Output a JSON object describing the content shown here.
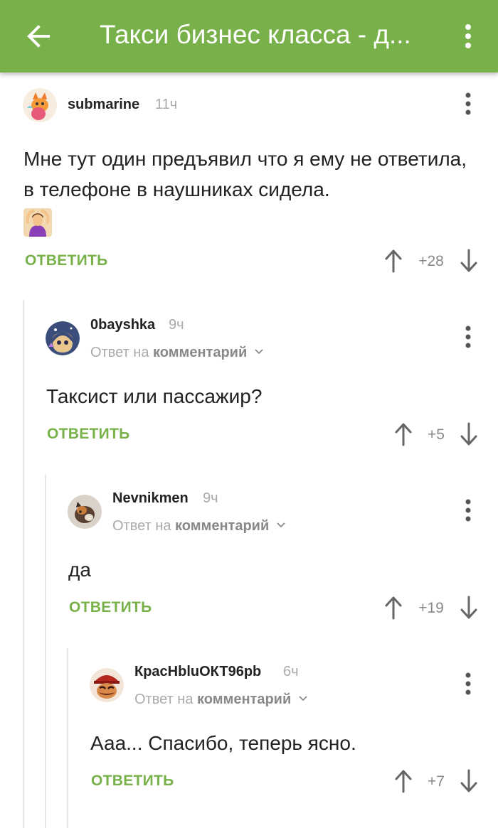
{
  "appbar": {
    "title": "Такси бизнес класса - д...",
    "back_icon": "arrow-left-icon",
    "menu_icon": "more-vert-icon",
    "color": "#78b04a"
  },
  "comments": [
    {
      "author": "submarine",
      "time": "11ч",
      "reply_to": "",
      "text": "Мне тут один предъявил что я ему не ответила, в телефоне в наушниках сидела.",
      "reply_label": "ОТВЕТИТЬ",
      "rating": "+28",
      "emoji": "woman-gesturing-ok-emoji"
    },
    {
      "author": "0bayshka",
      "time": "9ч",
      "reply_prefix": "Ответ на",
      "reply_to": "комментарий",
      "text": "Таксист или пассажир?",
      "reply_label": "ОТВЕТИТЬ",
      "rating": "+5"
    },
    {
      "author": "Nevnikmen",
      "time": "9ч",
      "reply_prefix": "Ответ на",
      "reply_to": "комментарий",
      "text": "да",
      "reply_label": "ОТВЕТИТЬ",
      "rating": "+19"
    },
    {
      "author": "КрасНbluОКТ96pb",
      "time": "6ч",
      "reply_prefix": "Ответ на",
      "reply_to": "комментарий",
      "text": "Ааа... Спасибо, теперь ясно.",
      "reply_label": "ОТВЕТИТЬ",
      "rating": "+7"
    }
  ]
}
